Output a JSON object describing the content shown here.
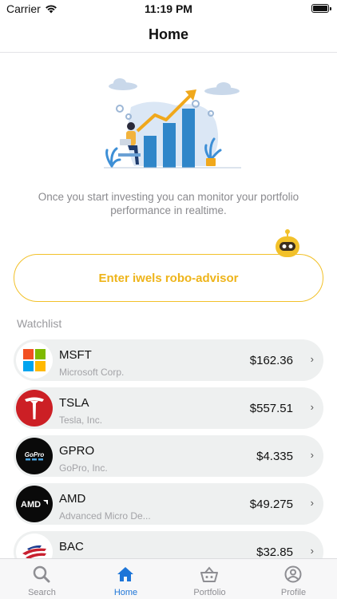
{
  "status_bar": {
    "carrier": "Carrier",
    "time": "11:19 PM"
  },
  "header": {
    "title": "Home"
  },
  "empty_state": {
    "text": "Once you start investing you can monitor your portfolio performance in realtime."
  },
  "robo_advisor": {
    "label": "Enter iwels robo-advisor",
    "accent": "#f2c12a"
  },
  "watchlist": {
    "label": "Watchlist",
    "items": [
      {
        "symbol": "MSFT",
        "name": "Microsoft Corp.",
        "price": "$162.36"
      },
      {
        "symbol": "TSLA",
        "name": "Tesla, Inc.",
        "price": "$557.51"
      },
      {
        "symbol": "GPRO",
        "name": "GoPro, Inc.",
        "price": "$4.335"
      },
      {
        "symbol": "AMD",
        "name": "Advanced Micro De...",
        "price": "$49.275"
      },
      {
        "symbol": "BAC",
        "name": "",
        "price": "$32.85"
      }
    ]
  },
  "tab_bar": {
    "active_color": "#1d75d8",
    "tabs": [
      {
        "label": "Search",
        "icon": "search-icon"
      },
      {
        "label": "Home",
        "icon": "home-icon"
      },
      {
        "label": "Portfolio",
        "icon": "basket-icon"
      },
      {
        "label": "Profile",
        "icon": "profile-icon"
      }
    ],
    "active_tab": "Home"
  }
}
